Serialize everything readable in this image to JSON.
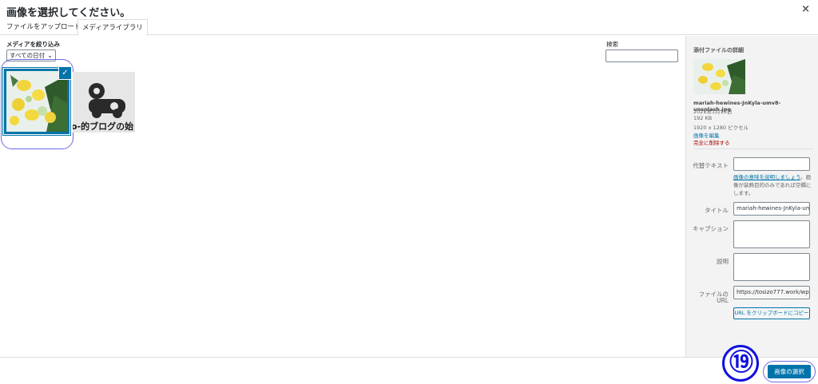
{
  "modal": {
    "title": "画像を選択してください。",
    "close": "×"
  },
  "tabs": [
    {
      "label": "ファイルをアップロード"
    },
    {
      "label": "メディアライブラリ"
    }
  ],
  "filter": {
    "label": "メディアを絞り込み",
    "date_value": "すべての日付"
  },
  "search": {
    "label": "検索",
    "value": ""
  },
  "thumbnails": [
    {
      "selected": true,
      "description": "lemons photo"
    },
    {
      "selected": false,
      "text": "o-的ブログの始"
    }
  ],
  "details": {
    "heading": "添付ファイルの詳細",
    "filename": "mariah-hewines-JnKyla-umv8-unsplash.jpg",
    "date": "2021年1月15日",
    "size": "192 KB",
    "dimensions": "1920 x 1280 ピクセル",
    "edit_link": "画像を編集",
    "delete_link": "完全に削除する"
  },
  "form": {
    "alt_label": "代替テキスト",
    "alt_value": "",
    "alt_help_link": "画像の意味を説明しましょう",
    "alt_help_tail": "。画像が装飾目的のみであれば空欄にします。",
    "title_label": "タイトル",
    "title_value": "mariah-hewines-JnKyla-um",
    "caption_label": "キャプション",
    "caption_value": "",
    "description_label": "説明",
    "description_value": "",
    "url_label_1": "ファイルの",
    "url_label_2": "URL",
    "url_value": "https://tosizo777.work/wp-",
    "copy_label": "URL をクリップボードにコピー"
  },
  "footer": {
    "select_label": "画像の選択",
    "step": "⑲"
  },
  "colors": {
    "accent": "#0073aa",
    "annotation": "#6b6be0",
    "badge": "#1010e0",
    "delete": "#aa0000"
  }
}
